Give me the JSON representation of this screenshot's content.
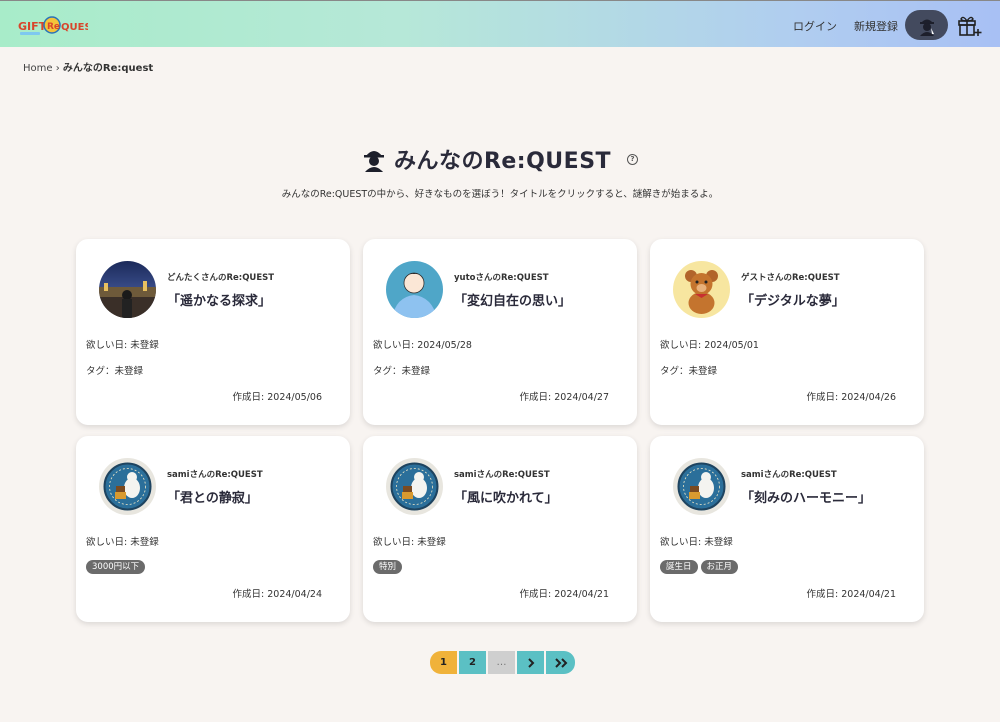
{
  "header": {
    "logo_text": "GIFT QUEST",
    "login_label": "ログイン",
    "signup_label": "新規登録"
  },
  "breadcrumb": {
    "home": "Home",
    "separator": "›",
    "current": "みんなのRe:quest"
  },
  "page": {
    "title": "みんなのRe:QUEST",
    "subtitle": "みんなのRe:QUESTの中から、好きなものを選ぼう！タイトルをクリックすると、謎解きが始まるよ。"
  },
  "cards": [
    {
      "owner": "どんたくさんのRe:QUEST",
      "title": "「遥かなる探求」",
      "wanted": "欲しい日: 未登録",
      "tag_label": "タグ：未登録",
      "tags": [],
      "created": "作成日: 2024/05/06",
      "avatar": "city-night-photo"
    },
    {
      "owner": "yutoさんのRe:QUEST",
      "title": "「変幻自在の思い」",
      "wanted": "欲しい日: 2024/05/28",
      "tag_label": "タグ：未登録",
      "tags": [],
      "created": "作成日: 2024/04/27",
      "avatar": "person-illustration"
    },
    {
      "owner": "ゲストさんのRe:QUEST",
      "title": "「デジタルな夢」",
      "wanted": "欲しい日: 2024/05/01",
      "tag_label": "タグ：未登録",
      "tags": [],
      "created": "作成日: 2024/04/26",
      "avatar": "teddy-bear"
    },
    {
      "owner": "samiさんのRe:QUEST",
      "title": "「君との静寂」",
      "wanted": "欲しい日: 未登録",
      "tag_label": "",
      "tags": [
        "3000円以下"
      ],
      "created": "作成日: 2024/04/24",
      "avatar": "polar-bear-badge"
    },
    {
      "owner": "samiさんのRe:QUEST",
      "title": "「風に吹かれて」",
      "wanted": "欲しい日: 未登録",
      "tag_label": "",
      "tags": [
        "特別"
      ],
      "created": "作成日: 2024/04/21",
      "avatar": "polar-bear-badge"
    },
    {
      "owner": "samiさんのRe:QUEST",
      "title": "「刻みのハーモニー」",
      "wanted": "欲しい日: 未登録",
      "tag_label": "",
      "tags": [
        "誕生日",
        "お正月"
      ],
      "created": "作成日: 2024/04/21",
      "avatar": "polar-bear-badge"
    }
  ],
  "pagination": {
    "pages": [
      "1",
      "2"
    ],
    "dots": "…",
    "current": "1"
  },
  "colors": {
    "accent": "#f0b23a",
    "teal": "#5bc0c4",
    "tag_bg": "#6b6b6b"
  }
}
